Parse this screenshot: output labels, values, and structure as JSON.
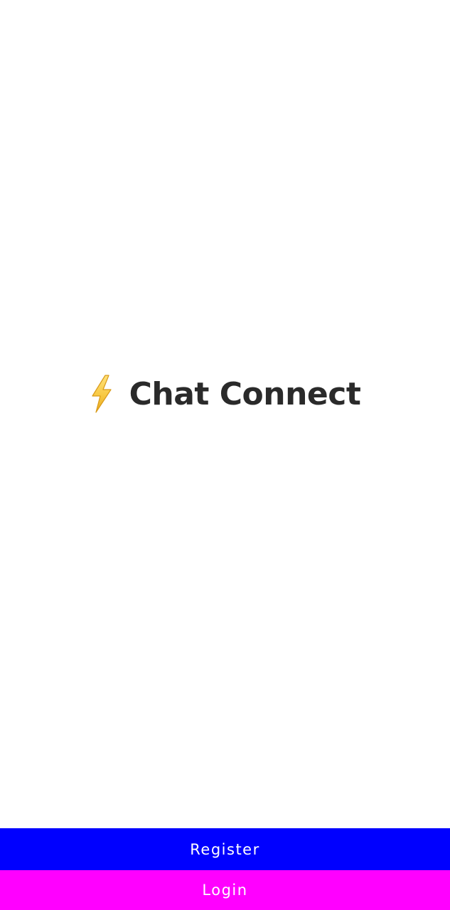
{
  "app": {
    "title": "Chat Connect",
    "logo_icon": "lightning-bolt-icon"
  },
  "actions": {
    "register_label": "Register",
    "login_label": "Login"
  },
  "colors": {
    "register_background": "#0000ff",
    "login_background": "#ff00ff",
    "button_text": "#ffffff",
    "title_text": "#2a2a2a",
    "bolt_fill": "#f7c843",
    "background": "#ffffff"
  }
}
